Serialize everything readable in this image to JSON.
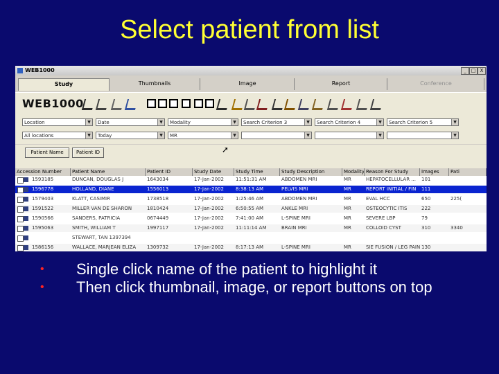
{
  "slide": {
    "title": "Select patient from list",
    "bullets": [
      "Single click name of the patient to highlight it",
      "Then click thumbnail, image, or report buttons on top"
    ]
  },
  "window": {
    "title": "WEB1000",
    "controls": [
      "_",
      "□",
      "X"
    ]
  },
  "tabs": [
    {
      "label": "Study",
      "active": true
    },
    {
      "label": "Thumbnails",
      "active": false
    },
    {
      "label": "Image",
      "active": false
    },
    {
      "label": "Report",
      "active": false
    },
    {
      "label": "Conference",
      "active": false,
      "disabled": true
    }
  ],
  "toolbar": {
    "logo": "WEB1000",
    "icons": [
      "brush-icon",
      "rotate-icon",
      "copy-icon",
      "refresh-icon",
      "layout-1x1-icon",
      "layout-2x2-icon",
      "layout-rows-icon",
      "layout-grid-icon",
      "layout-split-icon",
      "layout-multi-icon",
      "print-icon",
      "tools-icon",
      "compare-icon",
      "settings-icon",
      "annotate-icon",
      "measure-icon",
      "film-icon",
      "lock-icon",
      "trash-icon",
      "book-icon",
      "export-icon",
      "help-icon"
    ]
  },
  "filters": {
    "row1": [
      "Location",
      "Date",
      "Modality",
      "Search Criterion 3",
      "Search Criterion 4",
      "Search Criterion 5"
    ],
    "row2": [
      "All locations",
      "Today",
      "MR",
      "",
      "",
      ""
    ]
  },
  "buttons": {
    "patient_name": "Patient Name",
    "patient_id": "Patient ID"
  },
  "table": {
    "columns": [
      "Accession Number",
      "Patient Name",
      "Patient ID",
      "Study Date",
      "Study Time",
      "Study Description",
      "Modality",
      "Reason For Study",
      "Images",
      "Pati"
    ],
    "rows": [
      [
        "1593185",
        "DUNCAN, DOUGLAS J",
        "1643034",
        "17-Jan-2002",
        "11:51:31 AM",
        "ABDOMEN MRI",
        "MR",
        "HEPATOCELLULAR ...",
        "101",
        ""
      ],
      [
        "1596778",
        "HOLLAND, DIANE",
        "1556013",
        "17-Jan-2002",
        "8:38:13 AM",
        "PELVIS MRI",
        "MR",
        "REPORT INITIAL / FIN",
        "111",
        ""
      ],
      [
        "1579403",
        "KLATT, CASIMIR",
        "1738518",
        "17-Jan-2002",
        "1:25:46 AM",
        "ABDOMEN MRI",
        "MR",
        "EVAL HCC",
        "650",
        "225("
      ],
      [
        "1591522",
        "MILLER VAN DE SHARON",
        "1810424",
        "17-Jan-2002",
        "6:50:55 AM",
        "ANKLE MRI",
        "MR",
        "OSTEOCYTIC ITIS",
        "222",
        ""
      ],
      [
        "1590566",
        "SANDERS, PATRICIA",
        "0674449",
        "17-Jan-2002",
        "7:41:00 AM",
        "L-SPINE MRI",
        "MR",
        "SEVERE LBP",
        "79",
        ""
      ],
      [
        "1595063",
        "SMITH, WILLIAM T",
        "1997117",
        "17-Jan-2002",
        "11:11:14 AM",
        "BRAIN MRI",
        "MR",
        "COLLOID CYST",
        "310",
        "3340"
      ],
      [
        "",
        "STEWART, TAN  1397394",
        "",
        "",
        "",
        "",
        "",
        "",
        "",
        ""
      ],
      [
        "1586156",
        "WALLACE, MARJEAN ELIZA",
        "1309732",
        "17-Jan-2002",
        "8:17:13 AM",
        "L-SPINE MRI",
        "MR",
        "SIE FUSION / LEG PAIN",
        "130",
        ""
      ]
    ],
    "selected_row": 1
  }
}
